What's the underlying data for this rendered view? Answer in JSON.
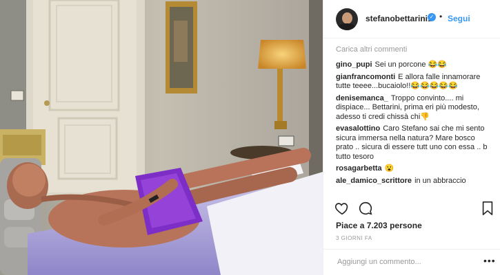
{
  "post": {
    "username": "stefanobettarini1",
    "verified_glyph": "✓",
    "separator": "•",
    "follow_label": "Segui",
    "load_more": "Carica altri commenti",
    "comments": [
      {
        "user": "gino_pupi",
        "text": "Sei un porcone 😂😂"
      },
      {
        "user": "gianfrancomonti",
        "text": "E allora falle innamorare tutte teeee...bucaiolo!!😂😂😂😂😂"
      },
      {
        "user": "denisemanca_",
        "text": "Troppo convinto.... mi dispiace... Bettarini, prima eri più modesto, adesso ti credi chissà chi👎"
      },
      {
        "user": "evasalottino",
        "text": "Caro Stefano sai che mi sento sicura immersa nella natura? Mare bosco prato .. sicura di essere tutt uno con essa .. b tutto tesoro"
      },
      {
        "user": "rosagarbetta",
        "text": "😮"
      },
      {
        "user": "ale_damico_scrittore",
        "text": "in un abbraccio"
      }
    ],
    "likes": "Piace a 7.203 persone",
    "date": "3 GIORNI FA",
    "add_comment_placeholder": "Aggiungi un commento...",
    "more_glyph": "•••"
  },
  "icons": {
    "like": "heart-icon",
    "comment": "comment-bubble-icon",
    "save": "bookmark-icon"
  },
  "colors": {
    "accent": "#3897f0",
    "text": "#262626",
    "muted": "#999999",
    "border": "#efefef"
  }
}
